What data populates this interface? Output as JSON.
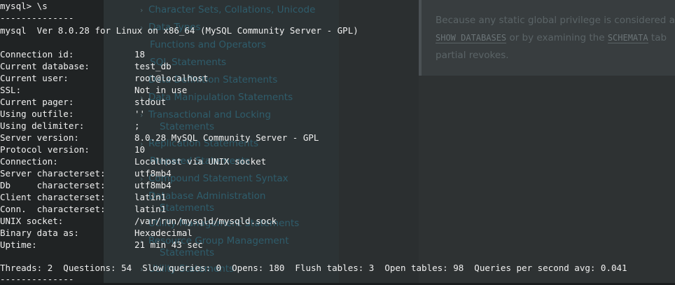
{
  "terminal": {
    "prompt_line": "mysql> \\s",
    "separator": "--------------",
    "version_line": "mysql  Ver 8.0.28 for Linux on x86_64 (MySQL Community Server - GPL)",
    "status": [
      {
        "label": "Connection id:",
        "value": "18"
      },
      {
        "label": "Current database:",
        "value": "test_db"
      },
      {
        "label": "Current user:",
        "value": "root@localhost"
      },
      {
        "label": "SSL:",
        "value": "Not in use"
      },
      {
        "label": "Current pager:",
        "value": "stdout"
      },
      {
        "label": "Using outfile:",
        "value": "''"
      },
      {
        "label": "Using delimiter:",
        "value": ";"
      },
      {
        "label": "Server version:",
        "value": "8.0.28 MySQL Community Server - GPL"
      },
      {
        "label": "Protocol version:",
        "value": "10"
      },
      {
        "label": "Connection:",
        "value": "Localhost via UNIX socket"
      },
      {
        "label": "Server characterset:",
        "value": "utf8mb4"
      },
      {
        "label": "Db     characterset:",
        "value": "utf8mb4"
      },
      {
        "label": "Client characterset:",
        "value": "latin1"
      },
      {
        "label": "Conn.  characterset:",
        "value": "latin1"
      },
      {
        "label": "UNIX socket:",
        "value": "/var/run/mysqld/mysqld.sock"
      },
      {
        "label": "Binary data as:",
        "value": "Hexadecimal"
      },
      {
        "label": "Uptime:",
        "value": "21 min 43 sec"
      }
    ],
    "threads_line": "Threads: 2  Questions: 54  Slow queries: 0  Opens: 180  Flush tables: 3  Open tables: 98  Queries per second avg: 0.041",
    "separator_end": "--------------"
  },
  "background_doc": {
    "nav_items": [
      {
        "label": "Character Sets, Collations, Unicode",
        "chevron": true
      },
      {
        "label": "Data Types",
        "chevron": true
      },
      {
        "label": "Functions and Operators",
        "chevron": false
      },
      {
        "label": "SQL Statements",
        "chevron": false
      },
      {
        "label": "Data Definition Statements",
        "chevron": true
      },
      {
        "label": "Data Manipulation Statements",
        "chevron": true
      },
      {
        "label": "Transactional and Locking",
        "chevron": true
      },
      {
        "label": "Statements",
        "chevron": false
      },
      {
        "label": "Replication Statements",
        "chevron": true
      },
      {
        "label": "Prepared Statements",
        "chevron": false
      },
      {
        "label": "Compound Statement Syntax",
        "chevron": true
      },
      {
        "label": "Database Administration",
        "chevron": true
      },
      {
        "label": "Statements",
        "chevron": false
      },
      {
        "label": "Utility Management Statements",
        "chevron": true
      },
      {
        "label": "Resource Group Management",
        "chevron": true
      },
      {
        "label": "Statements",
        "chevron": false
      },
      {
        "label": "Utility Statements",
        "chevron": true
      }
    ],
    "callout": {
      "line1": "Because any static global privilege is considered a p",
      "line2_code1": "SHOW DATABASES",
      "line2_mid": " or by examining the ",
      "line2_code2": "SCHEMATA",
      "line2_end": " tab",
      "line3": "partial revokes."
    }
  }
}
